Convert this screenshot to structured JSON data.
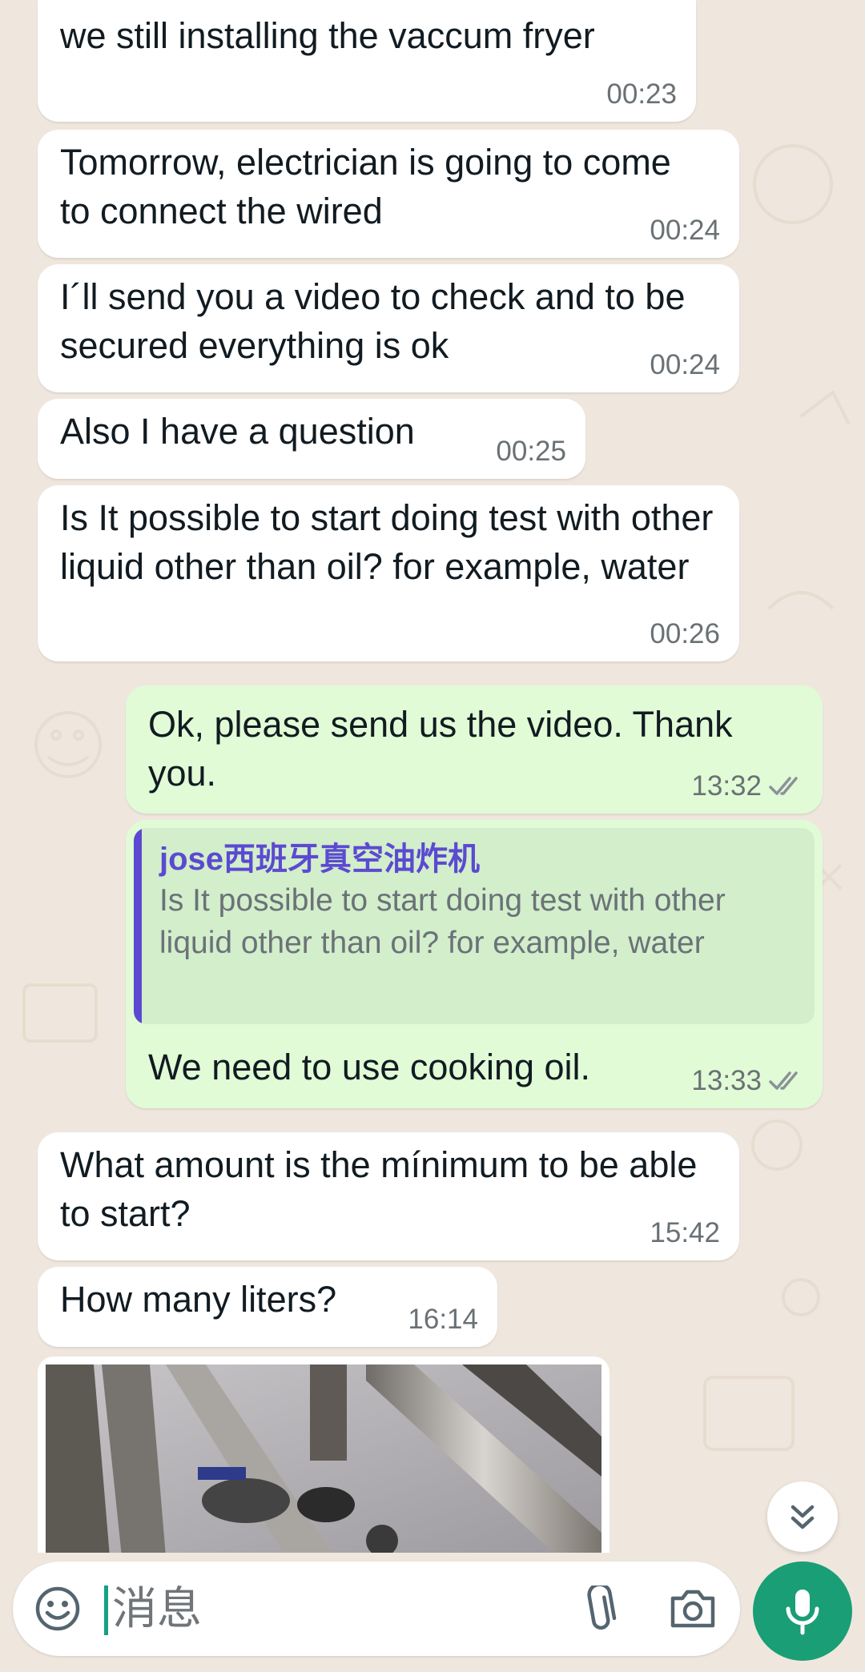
{
  "messages": [
    {
      "text": "we still installing the vaccum fryer",
      "time": "00:23"
    },
    {
      "text": "Tomorrow, electrician is going to come to connect the wired",
      "time": "00:24"
    },
    {
      "text": "I´ll send you a video to check and to be secured everything is ok",
      "time": "00:24"
    },
    {
      "text": "Also I have a question",
      "time": "00:25"
    },
    {
      "text": "Is It possible to start doing test with other liquid other than oil? for example, water",
      "time": "00:26"
    },
    {
      "text": "Ok, please send us the video. Thank you.",
      "time": "13:32",
      "status": "read"
    },
    {
      "quote_author": "jose西班牙真空油炸机",
      "quote_text": "Is It possible to start doing test with other liquid other than oil? for example, water",
      "text": "We need to use cooking oil.",
      "time": "13:33",
      "status": "read"
    },
    {
      "text": "What amount is the mínimum to be able to start?",
      "time": "15:42"
    },
    {
      "text": "How many liters?",
      "time": "16:14"
    }
  ],
  "composer": {
    "placeholder": "消息"
  },
  "icons": {
    "emoji": "emoji-icon",
    "attach": "paperclip-icon",
    "camera": "camera-icon",
    "mic": "microphone-icon",
    "scroll": "double-chevron-down-icon",
    "ticks": "double-check-icon"
  },
  "colors": {
    "incoming_bubble": "#ffffff",
    "outgoing_bubble": "#e1fbd6",
    "quote_accent": "#5b4ad1",
    "read_ticks": "#8a9297",
    "mic_button": "#1a9e76",
    "chat_background": "#efe7de"
  }
}
